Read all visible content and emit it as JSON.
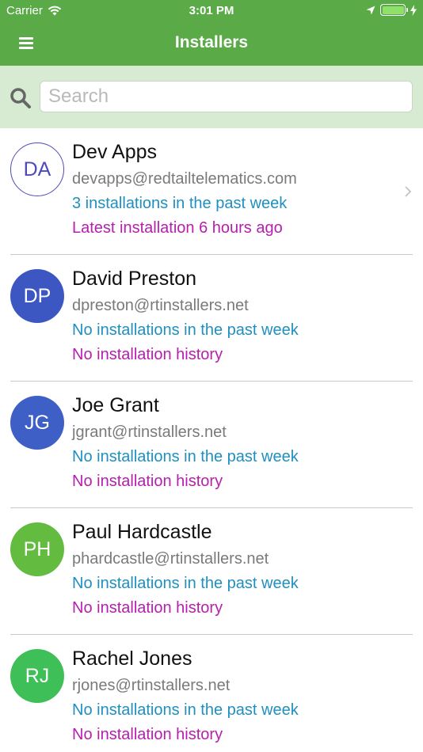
{
  "status_bar": {
    "carrier": "Carrier",
    "time": "3:01 PM"
  },
  "nav": {
    "title": "Installers",
    "menu_icon": "hamburger-menu-icon"
  },
  "search": {
    "placeholder": "Search",
    "value": ""
  },
  "colors": {
    "header": "#5aab47",
    "search_bar": "#d6ebd2",
    "week_text": "#1f8fc0",
    "history_text": "#b51fae"
  },
  "installers": [
    {
      "initials": "DA",
      "name": "Dev Apps",
      "email": "devapps@redtailtelematics.com",
      "week": "3 installations in the past week",
      "history": "Latest installation 6 hours ago",
      "avatar_color": "#ffffff",
      "avatar_style": "outline"
    },
    {
      "initials": "DP",
      "name": "David Preston",
      "email": "dpreston@rtinstallers.net",
      "week": "No installations in the past week",
      "history": "No installation history",
      "avatar_color": "#3d57c2",
      "avatar_style": "filled"
    },
    {
      "initials": "JG",
      "name": "Joe Grant",
      "email": "jgrant@rtinstallers.net",
      "week": "No installations in the past week",
      "history": "No installation history",
      "avatar_color": "#3d5fc6",
      "avatar_style": "filled"
    },
    {
      "initials": "PH",
      "name": "Paul Hardcastle",
      "email": "phardcastle@rtinstallers.net",
      "week": "No installations in the past week",
      "history": "No installation history",
      "avatar_color": "#63bb40",
      "avatar_style": "filled"
    },
    {
      "initials": "RJ",
      "name": "Rachel Jones",
      "email": "rjones@rtinstallers.net",
      "week": "No installations in the past week",
      "history": "No installation history",
      "avatar_color": "#3fbf57",
      "avatar_style": "filled"
    }
  ]
}
